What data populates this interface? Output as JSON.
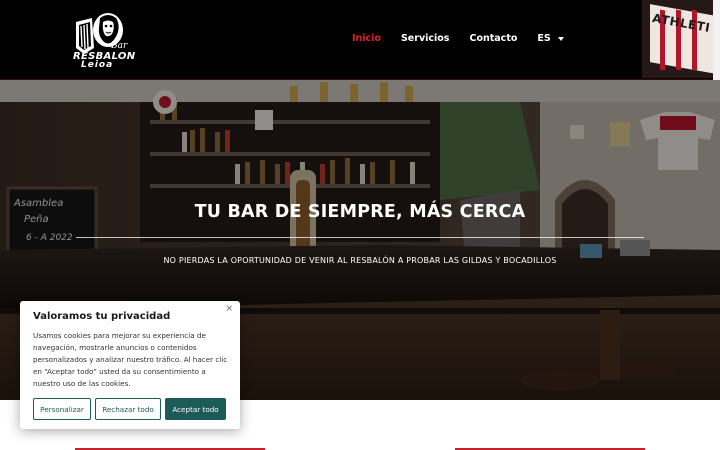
{
  "header": {
    "logo": {
      "bar": "Bar",
      "name": "RESBALON",
      "place": "Leioa"
    },
    "nav": [
      {
        "label": "Inicio",
        "active": true
      },
      {
        "label": "Servicios",
        "active": false
      },
      {
        "label": "Contacto",
        "active": false
      }
    ],
    "language": "ES",
    "photo_text": "ATHLETI"
  },
  "hero": {
    "title": "TU BAR DE SIEMPRE, MÁS CERCA",
    "subtitle": "NO PIERDAS LA OPORTUNIDAD DE VENIR AL RESBALÓN A PROBAR LAS GILDAS Y BOCADILLOS",
    "chalkboard": [
      "Asamblea",
      "Peña",
      "6 - A 2022"
    ]
  },
  "cookie": {
    "title": "Valoramos tu privacidad",
    "text": "Usamos cookies para mejorar su experiencia de navegación, mostrarle anuncios o contenidos personalizados y analizar nuestro tráfico. Al hacer clic en “Aceptar todo” usted da su consentimiento a nuestro uso de las cookies.",
    "customize": "Personalizar",
    "reject": "Rechazar todo",
    "accept": "Aceptar todo",
    "close": "×"
  },
  "colors": {
    "accent": "#e0202a",
    "cookie_button": "#1d5b59",
    "header_bg": "#000000"
  }
}
